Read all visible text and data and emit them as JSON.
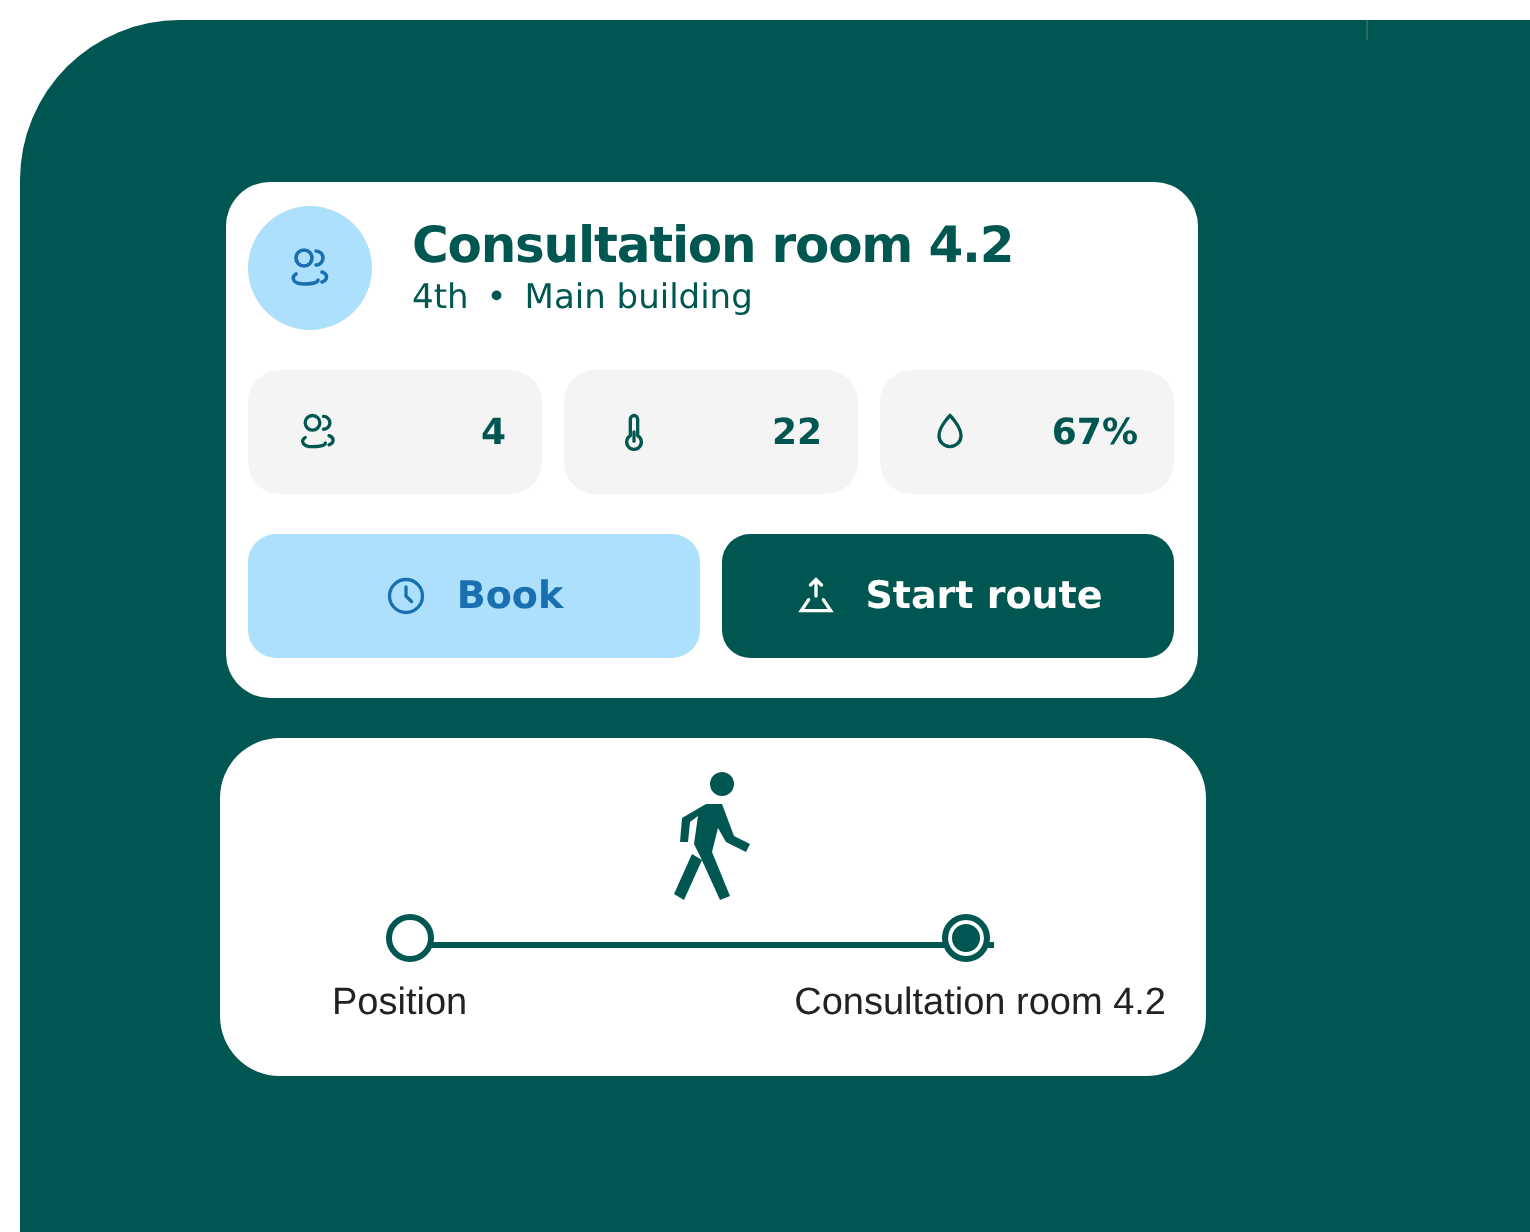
{
  "room": {
    "title": "Consultation room 4.2",
    "floor": "4th",
    "separator": "•",
    "building": "Main building"
  },
  "stats": [
    {
      "kind": "people",
      "value": "4"
    },
    {
      "kind": "temperature",
      "value": "22"
    },
    {
      "kind": "humidity",
      "value": "67%"
    }
  ],
  "buttons": [
    {
      "kind": "book",
      "label": "Book"
    },
    {
      "kind": "route",
      "label": "Start route"
    }
  ],
  "route": {
    "stops": [
      {
        "label": "Position",
        "kind": "origin"
      },
      {
        "label": "Consultation room 4.2",
        "kind": "destination"
      }
    ]
  }
}
